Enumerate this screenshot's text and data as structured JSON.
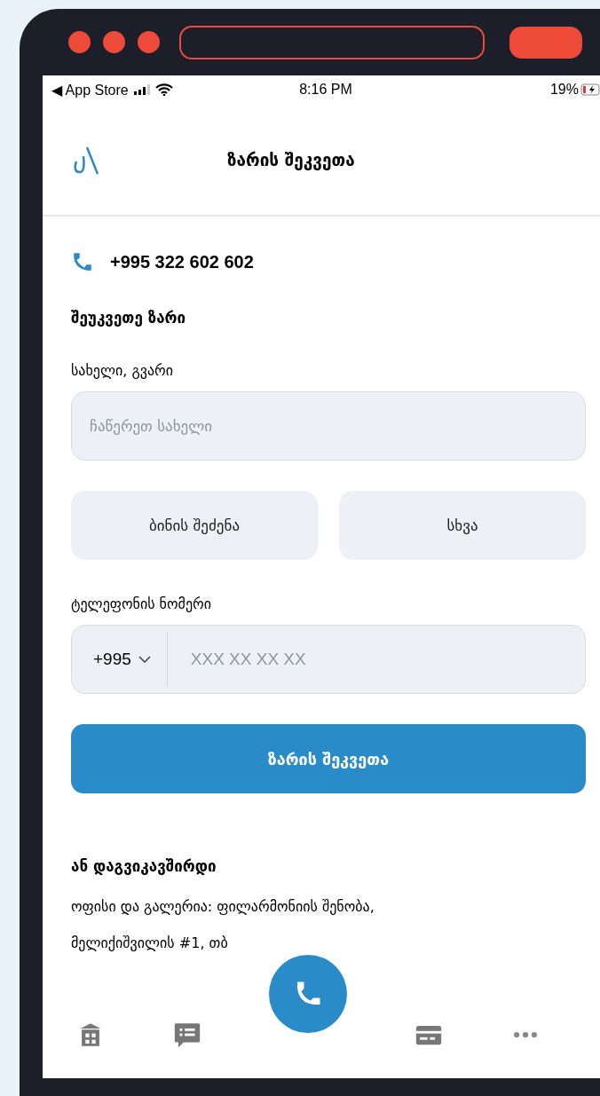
{
  "status_bar": {
    "back_label": "◀ App Store",
    "time": "8:16 PM",
    "battery": "19%"
  },
  "header": {
    "title": "ზარის შეკვეთა"
  },
  "contact_phone": "+995 322 602 602",
  "form": {
    "heading": "შეუკვეთე ზარი",
    "name_label": "სახელი, გვარი",
    "name_placeholder": "ჩაწერეთ სახელი",
    "topics": [
      {
        "label": "ბინის შეძენა"
      },
      {
        "label": "სხვა"
      }
    ],
    "phone_label": "ტელეფონის ნომერი",
    "country_code": "+995",
    "phone_placeholder": "XXX XX XX XX",
    "submit": "ზარის შეკვეთა"
  },
  "contact": {
    "heading": "ან დაგვიკავშირდი",
    "lines": [
      "ოფისი და გალერია: ფილარმონიის შენობა,",
      "მელიქიშვილის #1, თბ"
    ]
  },
  "tab_bar": [
    {
      "kind": "building"
    },
    {
      "kind": "chat"
    },
    {
      "kind": "call"
    },
    {
      "kind": "card"
    },
    {
      "kind": "more"
    }
  ]
}
